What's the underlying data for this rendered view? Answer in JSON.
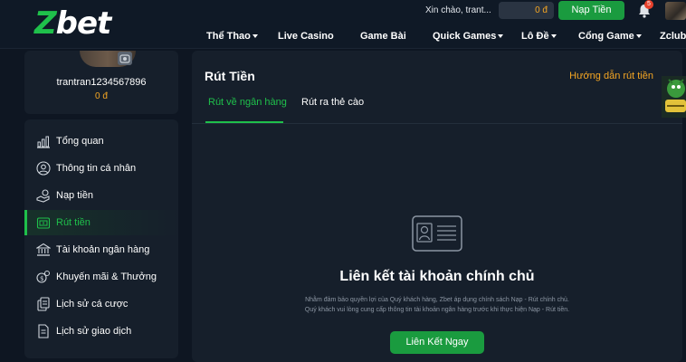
{
  "brand": {
    "logo_z": "Z",
    "logo_rest": "bet"
  },
  "header": {
    "greeting": "Xin chào, trant...",
    "balance": "0 đ",
    "deposit_label": "Nạp Tiền",
    "notification_count": "5"
  },
  "nav": [
    {
      "label": "Thể Thao",
      "dropdown": true
    },
    {
      "label": "Live Casino",
      "dropdown": false
    },
    {
      "label": "Game Bài",
      "dropdown": false
    },
    {
      "label": "Quick Games",
      "dropdown": true
    },
    {
      "label": "Lô Đề",
      "dropdown": true
    },
    {
      "label": "Cổng Game",
      "dropdown": true
    },
    {
      "label": "Zclub",
      "dropdown": false
    }
  ],
  "sidebar": {
    "username": "trantran1234567896",
    "balance": "0 đ",
    "items": [
      {
        "label": "Tổng quan",
        "icon": "chart-icon"
      },
      {
        "label": "Thông tin cá nhân",
        "icon": "user-icon"
      },
      {
        "label": "Nạp tiền",
        "icon": "hand-coin-icon"
      },
      {
        "label": "Rút tiền",
        "icon": "withdraw-icon",
        "active": true
      },
      {
        "label": "Tài khoản ngân hàng",
        "icon": "bank-icon"
      },
      {
        "label": "Khuyến mãi & Thưởng",
        "icon": "gift-icon"
      },
      {
        "label": "Lịch sử cá cược",
        "icon": "history-bet-icon"
      },
      {
        "label": "Lịch sử giao dịch",
        "icon": "document-icon"
      }
    ]
  },
  "main": {
    "title": "Rút Tiền",
    "guide_link": "Hướng dẫn rút tiền",
    "tabs": [
      {
        "label": "Rút về ngân hàng",
        "active": true
      },
      {
        "label": "Rút ra thẻ cào",
        "active": false
      }
    ],
    "empty_state": {
      "icon": "id-card-icon",
      "title": "Liên kết tài khoản chính chủ",
      "desc_line1": "Nhằm đảm bảo quyền lợi của Quý khách hàng, Zbet áp dụng chính sách Nạp - Rút chính chủ.",
      "desc_line2": "Quý khách vui lòng cung cấp thông tin tài khoản ngân hàng trước khi thực hiện Nạp - Rút tiền.",
      "button_label": "Liên Kết Ngay"
    }
  },
  "colors": {
    "accent_green": "#1fc04b",
    "button_green": "#1a9b3f",
    "gold": "#f5a623",
    "background": "#0e1622",
    "panel": "#161f2b"
  }
}
